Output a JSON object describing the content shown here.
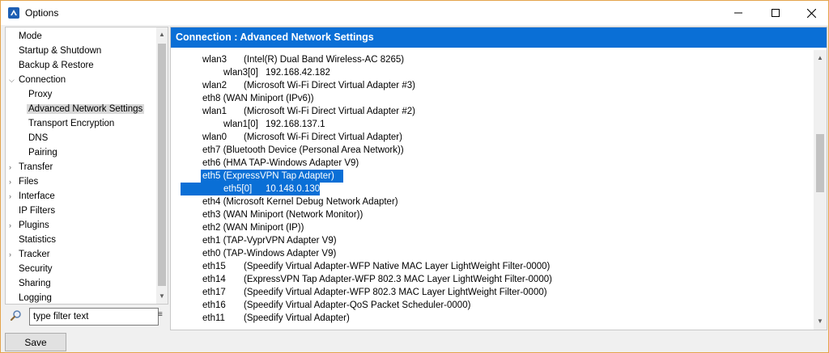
{
  "window": {
    "title": "Options"
  },
  "tree": {
    "items": [
      {
        "label": "Mode"
      },
      {
        "label": "Startup & Shutdown"
      },
      {
        "label": "Backup & Restore"
      },
      {
        "label": "Connection"
      },
      {
        "label": "Proxy"
      },
      {
        "label": "Advanced Network Settings"
      },
      {
        "label": "Transport Encryption"
      },
      {
        "label": "DNS"
      },
      {
        "label": "Pairing"
      },
      {
        "label": "Transfer"
      },
      {
        "label": "Files"
      },
      {
        "label": "Interface"
      },
      {
        "label": "IP Filters"
      },
      {
        "label": "Plugins"
      },
      {
        "label": "Statistics"
      },
      {
        "label": "Tracker"
      },
      {
        "label": "Security"
      },
      {
        "label": "Sharing"
      },
      {
        "label": "Logging"
      }
    ],
    "selected": "Advanced Network Settings"
  },
  "filter": {
    "placeholder": "type filter text"
  },
  "section": {
    "title": "Connection : Advanced Network Settings"
  },
  "network": {
    "rows": [
      {
        "name": "wlan3",
        "desc": "(Intel(R) Dual Band Wireless-AC 8265)"
      },
      {
        "name": "wlan3[0]",
        "desc": "192.168.42.182"
      },
      {
        "name": "wlan2",
        "desc": "(Microsoft Wi-Fi Direct Virtual Adapter #3)"
      },
      {
        "name": "eth8 (WAN Miniport (IPv6))",
        "desc": ""
      },
      {
        "name": "wlan1",
        "desc": "(Microsoft Wi-Fi Direct Virtual Adapter #2)"
      },
      {
        "name": "wlan1[0]",
        "desc": "192.168.137.1"
      },
      {
        "name": "wlan0",
        "desc": "(Microsoft Wi-Fi Direct Virtual Adapter)"
      },
      {
        "name": "eth7 (Bluetooth Device (Personal Area Network))",
        "desc": ""
      },
      {
        "name": "eth6 (HMA TAP-Windows Adapter V9)",
        "desc": ""
      },
      {
        "name": "eth5 (ExpressVPN Tap Adapter)",
        "desc": ""
      },
      {
        "name": "eth5[0]",
        "desc": "10.148.0.130"
      },
      {
        "name": "eth4 (Microsoft Kernel Debug Network Adapter)",
        "desc": ""
      },
      {
        "name": "eth3 (WAN Miniport (Network Monitor))",
        "desc": ""
      },
      {
        "name": "eth2 (WAN Miniport (IP))",
        "desc": ""
      },
      {
        "name": "eth1 (TAP-VyprVPN Adapter V9)",
        "desc": ""
      },
      {
        "name": "eth0 (TAP-Windows Adapter V9)",
        "desc": ""
      },
      {
        "name": "eth15",
        "desc": "(Speedify Virtual Adapter-WFP Native MAC Layer LightWeight Filter-0000)"
      },
      {
        "name": "eth14",
        "desc": "(ExpressVPN Tap Adapter-WFP 802.3 MAC Layer LightWeight Filter-0000)"
      },
      {
        "name": "eth17",
        "desc": "(Speedify Virtual Adapter-WFP 802.3 MAC Layer LightWeight Filter-0000)"
      },
      {
        "name": "eth16",
        "desc": "(Speedify Virtual Adapter-QoS Packet Scheduler-0000)"
      },
      {
        "name": "eth11",
        "desc": "(Speedify Virtual Adapter)"
      }
    ]
  },
  "actions": {
    "save_label": "Save"
  },
  "colors": {
    "selection": "#0a6fd6",
    "window_border": "#e4a44c"
  }
}
